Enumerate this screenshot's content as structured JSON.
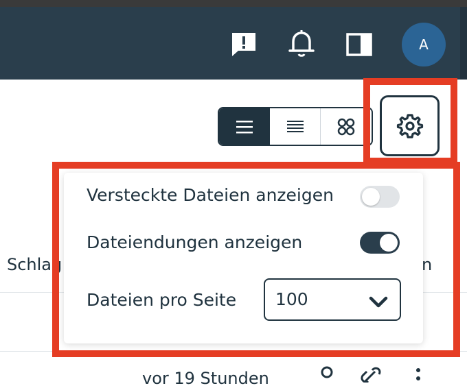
{
  "header": {
    "avatar_initial": "A",
    "icons": [
      "feedback-icon",
      "bell-icon",
      "sidebar-panel-icon"
    ]
  },
  "toolbar": {
    "views": [
      "list-view",
      "compact-list-view",
      "grid-view"
    ],
    "active_view": "list-view"
  },
  "table_fragments": {
    "column_header_left": "Schlag",
    "column_header_right": "n",
    "row_time": "vor 19 Stunden"
  },
  "settings_panel": {
    "hidden_files_label": "Versteckte Dateien anzeigen",
    "hidden_files_enabled": false,
    "extensions_label": "Dateiendungen anzeigen",
    "extensions_enabled": true,
    "per_page_label": "Dateien pro Seite",
    "per_page_value": "100"
  },
  "colors": {
    "header_bg": "#2a3e4c",
    "highlight": "#e53d24",
    "avatar_bg": "#2b6495",
    "text": "#20333f"
  }
}
